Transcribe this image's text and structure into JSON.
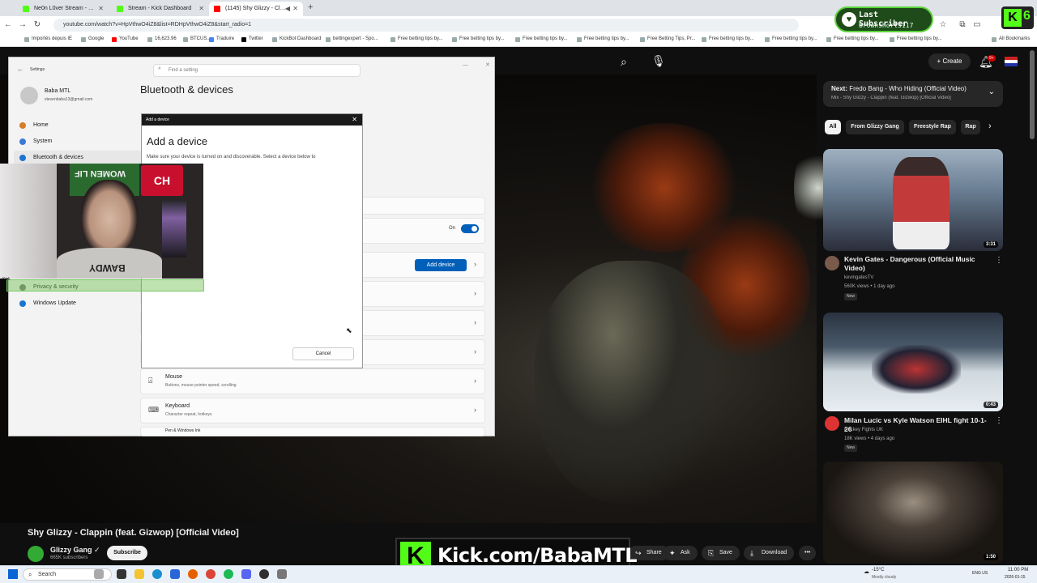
{
  "browser": {
    "tabs": [
      {
        "title": "Ne0n L0ver Stream - Watch Live",
        "fav_color": "#53fc18"
      },
      {
        "title": "Stream - Kick Dashboard",
        "fav_color": "#53fc18"
      },
      {
        "title": "(1145) Shy Glizzy - Clappin",
        "fav_color": "#ff0000"
      }
    ],
    "new_tab": "+",
    "url": "youtube.com/watch?v=HpVthwO4iZ8&list=RDHpVthwO4iZ8&start_radio=1",
    "bookmarks": [
      "Importés depuis IE",
      "Google",
      "YouTube",
      "16,623.96",
      "BTCUS...",
      "Traduire",
      "Twitter",
      "KickBot Dashboard",
      "bettingexpert - Spo...",
      "Free betting tips by...",
      "Free betting tips by...",
      "Free betting tips by...",
      "Free betting tips by...",
      "Free Betting Tips, Pr...",
      "Free betting tips by...",
      "Free betting tips by...",
      "Free betting tips by...",
      "Free betting tips by...",
      "All Bookmarks"
    ]
  },
  "alert": {
    "title": "Last Subscriber",
    "name": "brownshorts117"
  },
  "kick_counter": {
    "letter": "K",
    "number": "6"
  },
  "youtube": {
    "create_label": "Create",
    "notif_count": "9+",
    "video_title": "Shy Glizzy - Clappin (feat. Gizwop) [Official Video]",
    "channel": "Glizzy Gang",
    "subscribers": "665K subscribers",
    "subscribe_label": "Subscribe",
    "actions": {
      "share": "Share",
      "ask": "Ask",
      "save": "Save",
      "download": "Download"
    },
    "up_next": {
      "prefix": "Next:",
      "title": "Fredo Bang - Who Hiding (Official Video)",
      "sub": "Mix - Shy Glizzy - Clappin (feat. Gizwop) [Official Video]"
    },
    "chips": [
      "All",
      "From Glizzy Gang",
      "Freestyle Rap",
      "Rap"
    ],
    "related": [
      {
        "title": "Kevin Gates - Dangerous (Official Music Video)",
        "channel": "kevingatesTV",
        "meta": "560K views • 1 day ago",
        "badge": "New",
        "duration": "3:31"
      },
      {
        "title": "Milan Lucic vs Kyle Watson EIHL fight 10-1-26",
        "channel": "Hockey Fights UK",
        "meta": "18K views • 4 days ago",
        "badge": "New",
        "duration": "0:43"
      },
      {
        "duration": "1:50"
      }
    ]
  },
  "kick_banner": {
    "text": "Kick.com/BabaMTL",
    "letter": "K"
  },
  "settings": {
    "search_placeholder": "Find a setting",
    "user_name": "Baba MTL",
    "user_email": "stevenbaba13@gmail.com",
    "nav": [
      "Home",
      "System",
      "Bluetooth & devices",
      "Privacy & security",
      "Windows Update"
    ],
    "page_title": "Bluetooth & devices",
    "toggle_label": "On",
    "add_device_btn": "Add device",
    "rows": [
      {
        "title": "Mouse",
        "sub": "Buttons, mouse pointer speed, scrolling"
      },
      {
        "title": "Keyboard",
        "sub": "Character repeat, hotkeys"
      },
      {
        "title": "Pen & Windows Ink",
        "sub": ""
      }
    ]
  },
  "dialog": {
    "bar_title": "Add a device",
    "title": "Add a device",
    "description": "Make sure your device is turned on and discoverable. Select a device below to",
    "cancel": "Cancel"
  },
  "webcam": {
    "poster_text": "WOMEN LIF",
    "shirt_text": "BAWDY"
  },
  "overlay_label": "Kick",
  "taskbar": {
    "search": "Search",
    "weather_temp": "-15°C",
    "weather_desc": "Mostly cloudy",
    "lang": "ENG US",
    "time": "11:00 PM",
    "date": "2026-01-15"
  }
}
